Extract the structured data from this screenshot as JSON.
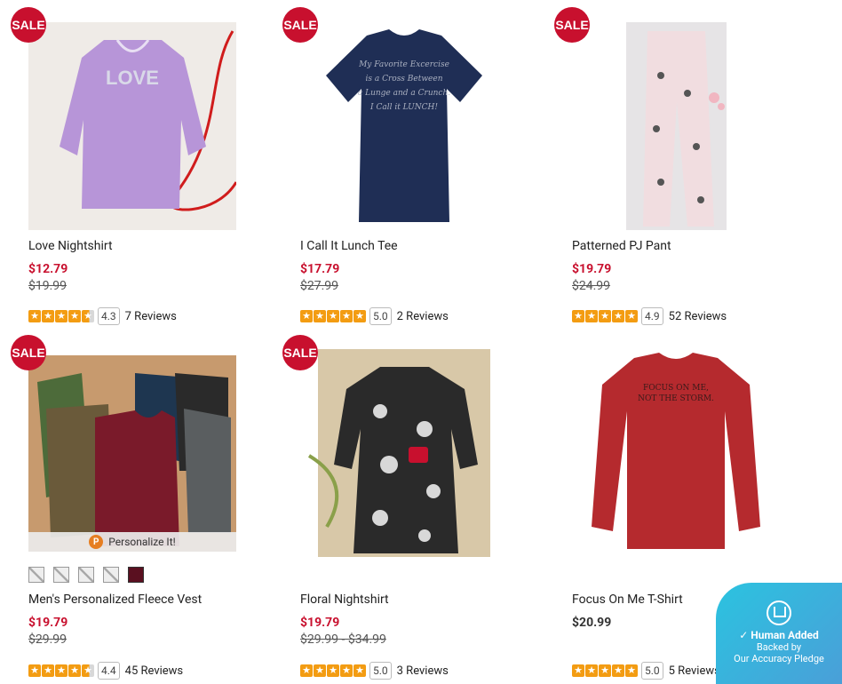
{
  "colors": {
    "sale": "#c8102e",
    "star": "#f39c12",
    "pledge": "#2bc3e0"
  },
  "sale_label": "SALE",
  "products": [
    {
      "title": "Love Nightshirt",
      "price": "$12.79",
      "was": "$19.99",
      "score": "4.3",
      "reviews": "7 Reviews",
      "rating": 4.3
    },
    {
      "title": "I Call It Lunch Tee",
      "price": "$17.79",
      "was": "$27.99",
      "score": "5.0",
      "reviews": "2 Reviews",
      "rating": 5.0
    },
    {
      "title": "Patterned PJ Pant",
      "price": "$19.79",
      "was": "$24.99",
      "score": "4.9",
      "reviews": "52 Reviews",
      "rating": 4.9
    },
    {
      "title": "Men's Personalized Fleece Vest",
      "price": "$19.79",
      "was": "$29.99",
      "score": "4.4",
      "reviews": "45 Reviews",
      "rating": 4.4,
      "personalize": "Personalize It!"
    },
    {
      "title": "Floral Nightshirt",
      "price": "$19.79",
      "was": "$29.99 - $34.99",
      "score": "5.0",
      "reviews": "3 Reviews",
      "rating": 5.0
    },
    {
      "title": "Focus On Me T-Shirt",
      "price": "$20.99",
      "score": "5.0",
      "reviews": "5 Reviews",
      "rating": 5.0
    }
  ],
  "product_images": {
    "love_text": "LOVE",
    "tee_lines": [
      "My Favorite Excercise",
      "is a Cross Between",
      "a Lunge and a Crunch.",
      "I Call it LUNCH!"
    ],
    "focus_lines": [
      "FOCUS ON ME,",
      "NOT THE STORM."
    ]
  },
  "pledge": {
    "title": "Human Added",
    "line1": "Backed by",
    "line2": "Our Accuracy Pledge"
  }
}
